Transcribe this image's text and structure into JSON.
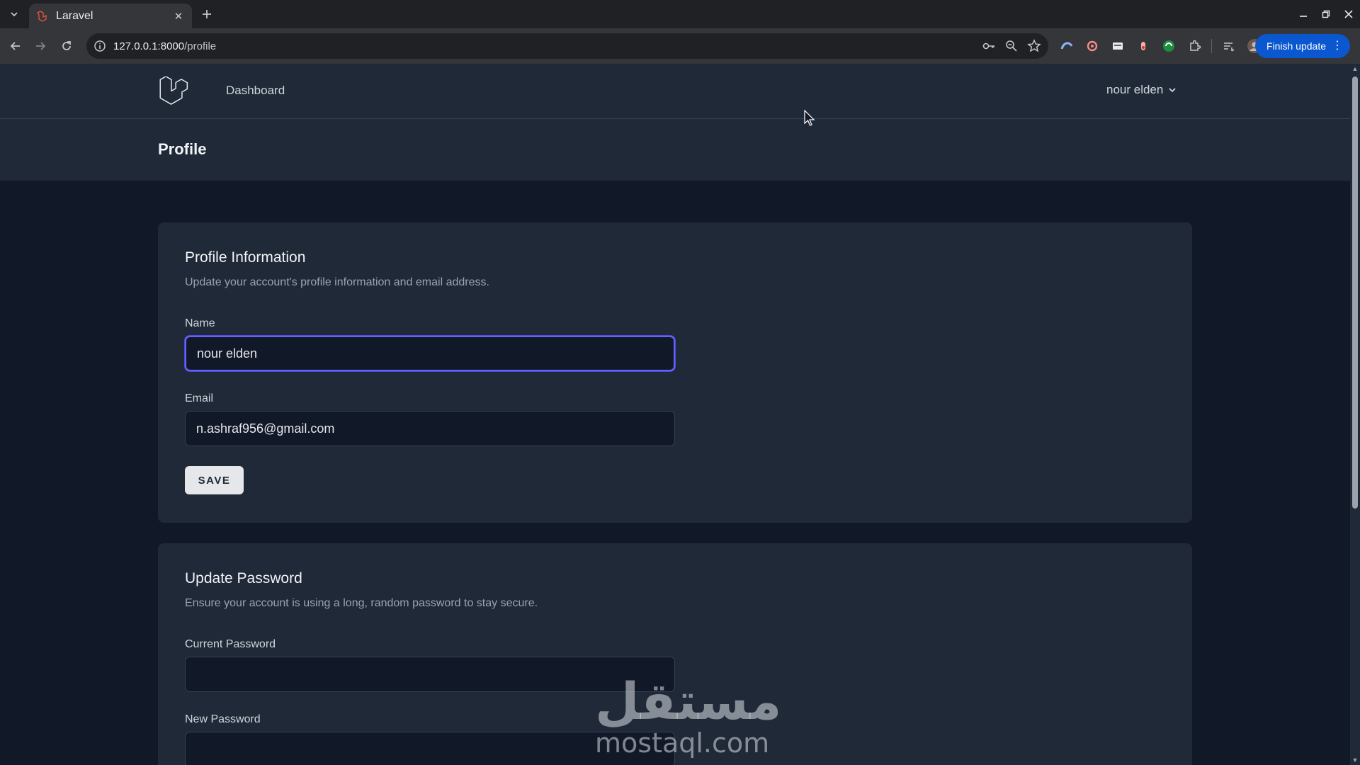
{
  "browser": {
    "tab_title": "Laravel",
    "url_host": "127.0.0.1:8000",
    "url_path": "/profile",
    "finish_update_label": "Finish update",
    "icons": [
      "tab-search-icon",
      "laravel-favicon-icon",
      "close-icon",
      "plus-icon",
      "minimize-icon",
      "restore-icon",
      "window-close-icon",
      "back-icon",
      "forward-icon",
      "reload-icon",
      "info-icon",
      "key-icon",
      "zoom-icon",
      "star-icon",
      "extension-icon",
      "menu-dots-icon"
    ]
  },
  "nav": {
    "dashboard_label": "Dashboard",
    "user_name": "nour elden"
  },
  "header": {
    "title": "Profile"
  },
  "profile_info": {
    "title": "Profile Information",
    "description": "Update your account's profile information and email address.",
    "name_label": "Name",
    "name_value": "nour elden",
    "email_label": "Email",
    "email_value": "n.ashraf956@gmail.com",
    "save_label": "SAVE"
  },
  "update_password": {
    "title": "Update Password",
    "description": "Ensure your account is using a long, random password to stay secure.",
    "current_password_label": "Current Password",
    "current_password_value": "",
    "new_password_label": "New Password",
    "new_password_value": ""
  },
  "watermark": {
    "arabic": "مستقل",
    "latin": "mostaql.com"
  },
  "colors": {
    "page_bg": "#111827",
    "card_bg": "#1f2937",
    "focus_ring": "#6366f1",
    "update_button": "#0b57d0"
  }
}
